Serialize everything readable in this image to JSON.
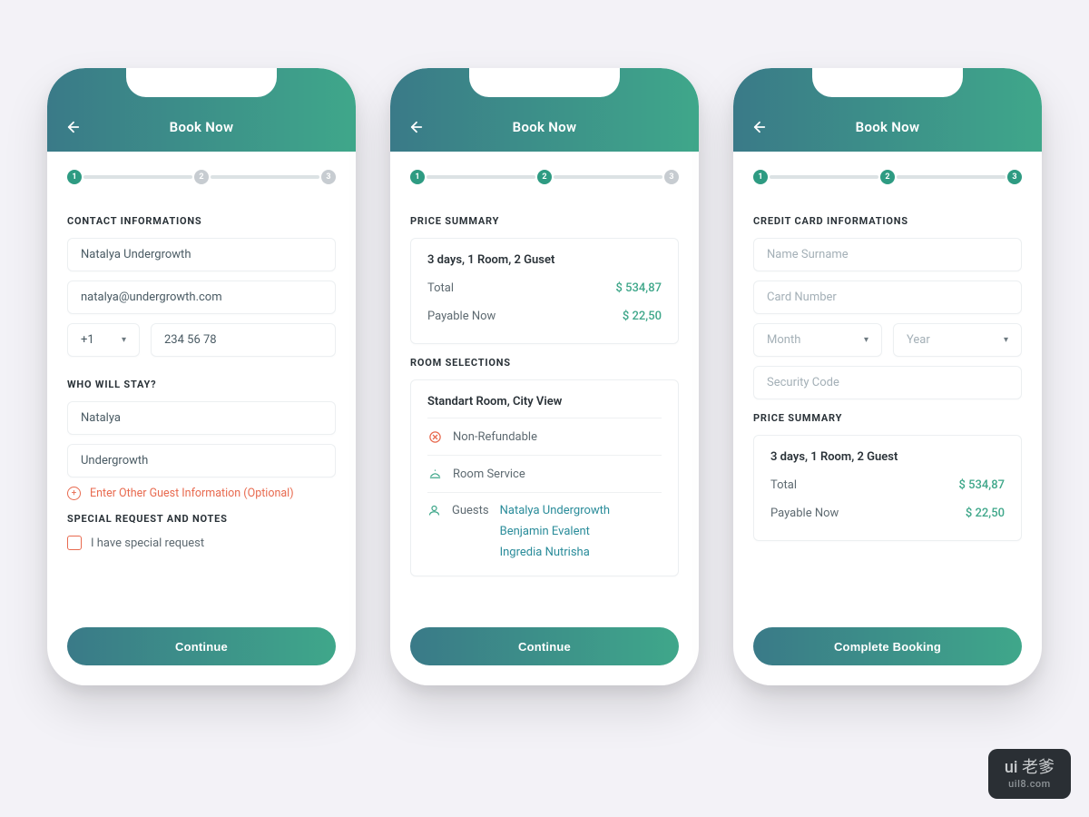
{
  "header": {
    "title": "Book Now"
  },
  "steps": [
    "1",
    "2",
    "3"
  ],
  "screen1": {
    "section_contact": "CONTACT INFORMATIONS",
    "name": "Natalya Undergrowth",
    "email": "natalya@undergrowth.com",
    "code": "+1",
    "phone": "234 56 78",
    "section_stay": "WHO WILL STAY?",
    "first": "Natalya",
    "last": "Undergrowth",
    "add_guest": "Enter Other Guest Information (Optional)",
    "section_notes": "SPECIAL REQUEST AND NOTES",
    "chk_label": "I have special request",
    "cta": "Continue"
  },
  "screen2": {
    "section_price": "PRICE SUMMARY",
    "summary_head": "3 days, 1 Room, 2 Guset",
    "total_label": "Total",
    "total_val": "$ 534,87",
    "pay_label": "Payable Now",
    "pay_val": "$ 22,50",
    "section_room": "ROOM SELECTIONS",
    "room_head": "Standart Room, City View",
    "nonref": "Non-Refundable",
    "service": "Room Service",
    "guests_label": "Guests",
    "guests": [
      "Natalya Undergrowth",
      "Benjamin Evalent",
      "Ingredia Nutrisha"
    ],
    "cta": "Continue"
  },
  "screen3": {
    "section_card": "CREDIT CARD INFORMATIONS",
    "p_name": "Name Surname",
    "p_card": "Card Number",
    "p_month": "Month",
    "p_year": "Year",
    "p_sec": "Security Code",
    "section_price": "PRICE SUMMARY",
    "summary_head": "3 days, 1 Room, 2 Guest",
    "total_label": "Total",
    "total_val": "$ 534,87",
    "pay_label": "Payable Now",
    "pay_val": "$ 22,50",
    "cta": "Complete Booking"
  },
  "watermark": {
    "brand": "ui 老爹",
    "url": "uil8.com"
  }
}
